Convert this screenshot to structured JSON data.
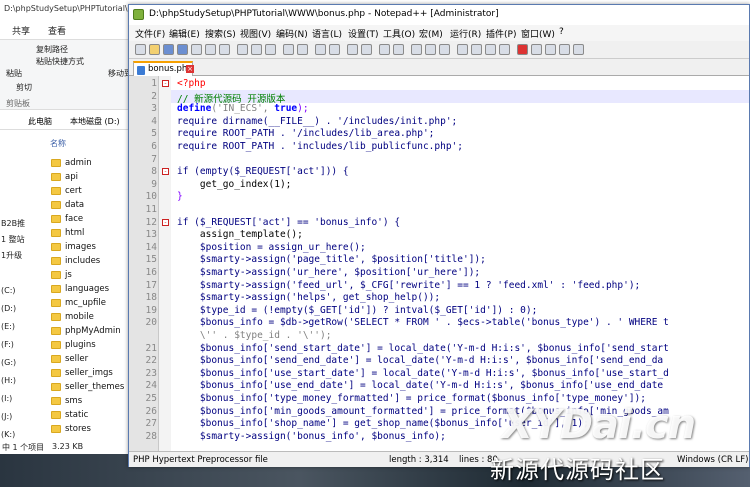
{
  "explorer": {
    "title": "D:\\phpStudySetup\\PHPTutorial\\WW",
    "tabs": [
      "共享",
      "查看"
    ],
    "ribbon": {
      "copy_path": "复制路径",
      "paste_shortcut": "粘贴快捷方式",
      "paste": "粘贴",
      "cut": "剪切",
      "move_to": "移动到",
      "clipboard": "剪贴板"
    },
    "address": [
      "此电脑",
      "本地磁盘 (D:)"
    ],
    "column_header": "名称",
    "nav_items": [
      "B2B推",
      "1 整站",
      "1升级",
      "(C:)",
      "(D:)",
      "(E:)",
      "(F:)",
      "(G:)",
      "(H:)",
      "(I:)",
      "(J:)",
      "(K:)"
    ],
    "folders": [
      "admin",
      "api",
      "cert",
      "data",
      "face",
      "html",
      "images",
      "includes",
      "js",
      "languages",
      "mc_upfile",
      "mobile",
      "phpMyAdmin",
      "plugins",
      "seller",
      "seller_imgs",
      "seller_themes",
      "sms",
      "static",
      "stores"
    ],
    "status_selected": "中 1 个项目",
    "status_size": "3.23 KB"
  },
  "notepad": {
    "title": "D:\\phpStudySetup\\PHPTutorial\\WWW\\bonus.php - Notepad++ [Administrator]",
    "menu": [
      "文件(F)",
      "编辑(E)",
      "搜索(S)",
      "视图(V)",
      "编码(N)",
      "语言(L)",
      "设置(T)",
      "工具(O)",
      "宏(M)",
      "运行(R)",
      "插件(P)",
      "窗口(W)",
      "?"
    ],
    "tab_label": "bonus.php",
    "status": {
      "lang": "PHP Hypertext Preprocessor file",
      "length": "length : 3,314",
      "lines": "lines : 80",
      "eol": "Windows (CR LF)"
    }
  },
  "code": {
    "l1": "<?php",
    "l2": "// 新源代源码 开源版本",
    "l3a": "define",
    "l3b": "('IN_ECS', ",
    "l3c": "true",
    "l3d": ");",
    "l4": "require dirname(__FILE__) . '/includes/init.php';",
    "l5": "require ROOT_PATH . '/includes/lib_area.php';",
    "l6": "require ROOT_PATH . 'includes/lib_publicfunc.php';",
    "l8": "if (empty($_REQUEST['act'])) {",
    "l9": "    get_go_index(1);",
    "l10": "}",
    "l12": "if ($_REQUEST['act'] == 'bonus_info') {",
    "l13": "    assign_template();",
    "l14": "    $position = assign_ur_here();",
    "l15": "    $smarty->assign('page_title', $position['title']);",
    "l16": "    $smarty->assign('ur_here', $position['ur_here']);",
    "l17": "    $smarty->assign('feed_url', $_CFG['rewrite'] == 1 ? 'feed.xml' : 'feed.php');",
    "l18": "    $smarty->assign('helps', get_shop_help());",
    "l19": "    $type_id = (!empty($_GET['id']) ? intval($_GET['id']) : 0);",
    "l20": "    $bonus_info = $db->getRow('SELECT * FROM ' . $ecs->table('bonus_type') . ' WHERE t",
    "l20b": "    \\'' . $type_id . '\\'');",
    "l21": "    $bonus_info['send_start_date'] = local_date('Y-m-d H:i:s', $bonus_info['send_start",
    "l22": "    $bonus_info['send_end_date'] = local_date('Y-m-d H:i:s', $bonus_info['send_end_da",
    "l23": "    $bonus_info['use_start_date'] = local_date('Y-m-d H:i:s', $bonus_info['use_start_d",
    "l24": "    $bonus_info['use_end_date'] = local_date('Y-m-d H:i:s', $bonus_info['use_end_date",
    "l25": "    $bonus_info['type_money_formatted'] = price_format($bonus_info['type_money']);",
    "l26": "    $bonus_info['min_goods_amount_formatted'] = price_format($bonus_info['min_goods_am",
    "l27": "    $bonus_info['shop_name'] = get_shop_name($bonus_info['user_id'], 1);",
    "l28": "    $smarty->assign('bonus_info', $bonus_info);"
  },
  "line_numbers": [
    "1",
    "2",
    "3",
    "4",
    "5",
    "6",
    "7",
    "8",
    "9",
    "10",
    "11",
    "12",
    "13",
    "14",
    "15",
    "16",
    "17",
    "18",
    "19",
    "20",
    "21",
    "22",
    "23",
    "24",
    "25",
    "26",
    "27",
    "28"
  ],
  "watermark": {
    "logo": "XYDai.cn",
    "sub": "新源代源码社区"
  }
}
